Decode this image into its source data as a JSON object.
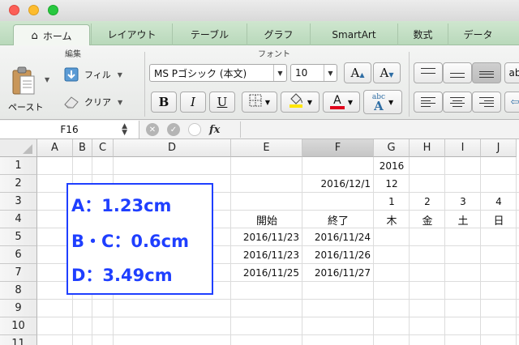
{
  "ribbon_tabs": [
    {
      "label": "ホーム"
    },
    {
      "label": "レイアウト"
    },
    {
      "label": "テーブル"
    },
    {
      "label": "グラフ"
    },
    {
      "label": "SmartArt"
    },
    {
      "label": "数式"
    },
    {
      "label": "データ"
    }
  ],
  "ribbon": {
    "edit_group_label": "編集",
    "font_group_label": "フォント",
    "paste_label": "ペースト",
    "fill_label": "フィル",
    "clear_label": "クリア",
    "font_name": "MS Pゴシック (本文)",
    "font_size": "10",
    "bold": "B",
    "italic": "I",
    "underline": "U",
    "abc": "abc",
    "cut_off_text": "ab"
  },
  "formula_bar": {
    "name_box": "F16",
    "fx": "fx",
    "formula": ""
  },
  "columns": [
    "A",
    "B",
    "C",
    "D",
    "E",
    "F",
    "G",
    "H",
    "I",
    "J"
  ],
  "selected_column": "F",
  "rows": [
    "1",
    "2",
    "3",
    "4",
    "5",
    "6",
    "7",
    "8",
    "9",
    "10",
    "11"
  ],
  "cells": {
    "G1": "2016",
    "F2": "2016/12/1",
    "G2": "12",
    "G3": "1",
    "H3": "2",
    "I3": "3",
    "J3": "4",
    "E4": "開始",
    "F4": "終了",
    "G4": "木",
    "H4": "金",
    "I4": "土",
    "J4": "日",
    "E5": "2016/11/23",
    "F5": "2016/11/24",
    "E6": "2016/11/23",
    "F6": "2016/11/26",
    "E7": "2016/11/25",
    "F7": "2016/11/27"
  },
  "textbox": {
    "line1": "A：1.23cm",
    "line2": "B・C：0.6cm",
    "line3": "D：3.49cm",
    "color": "#1f3fff"
  }
}
